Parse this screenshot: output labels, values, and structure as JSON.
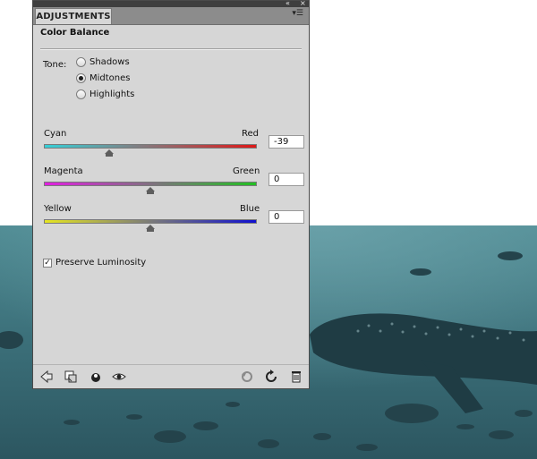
{
  "panel": {
    "tab_label": "ADJUSTMENTS",
    "collapse_icon": "double-arrow-icon",
    "close_icon": "close-icon",
    "menu_icon": "panel-menu-icon",
    "heading": "Color Balance"
  },
  "tone": {
    "label": "Tone:",
    "options": [
      {
        "label": "Shadows",
        "selected": false
      },
      {
        "label": "Midtones",
        "selected": true
      },
      {
        "label": "Highlights",
        "selected": false
      }
    ]
  },
  "sliders": [
    {
      "left_label": "Cyan",
      "right_label": "Red",
      "value": "-39",
      "min": -100,
      "max": 100,
      "left_color": "#35d0d8",
      "right_color": "#e01818"
    },
    {
      "left_label": "Magenta",
      "right_label": "Green",
      "value": "0",
      "min": -100,
      "max": 100,
      "left_color": "#e020e0",
      "right_color": "#22c022"
    },
    {
      "left_label": "Yellow",
      "right_label": "Blue",
      "value": "0",
      "min": -100,
      "max": 100,
      "left_color": "#e6e622",
      "right_color": "#1010d0"
    }
  ],
  "preserve_luminosity": {
    "label": "Preserve Luminosity",
    "checked": true
  },
  "bottom_icons": [
    "return-arrow-icon",
    "clip-to-layer-icon",
    "layer-visibility-toggle-icon",
    "eye-icon",
    "previous-state-icon",
    "reset-icon",
    "trash-icon"
  ]
}
